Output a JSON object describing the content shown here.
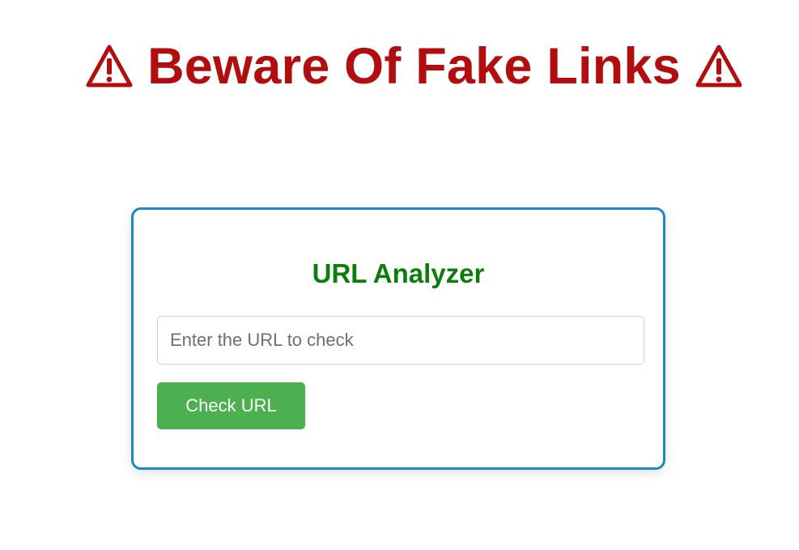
{
  "header": {
    "title": "Beware Of Fake Links",
    "icon": "warning-icon",
    "color": "#b20e10"
  },
  "analyzer": {
    "title": "URL Analyzer",
    "title_color": "#0a7d0a",
    "border_color": "#1a8bbf",
    "input": {
      "placeholder": "Enter the URL to check",
      "value": ""
    },
    "button_label": "Check URL",
    "button_color": "#4caf50"
  }
}
